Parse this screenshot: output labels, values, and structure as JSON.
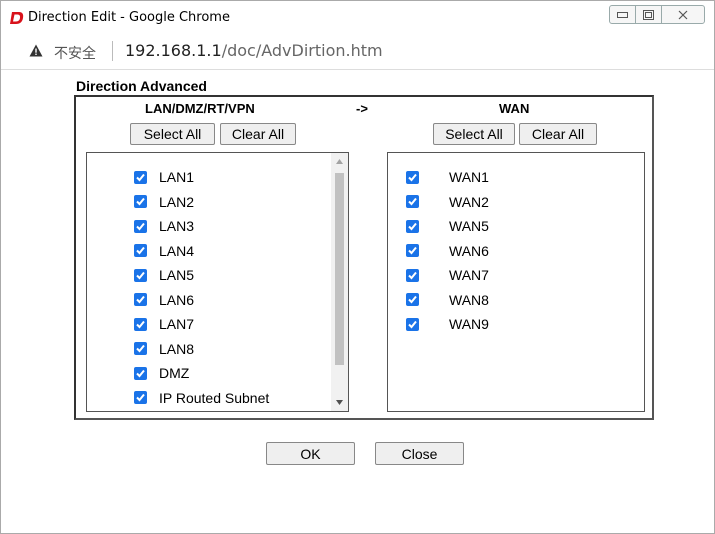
{
  "window": {
    "title": "Direction Edit - Google Chrome",
    "insecure_label": "不安全",
    "url_host": "192.168.1.1",
    "url_path": "/doc/AdvDirtion.htm"
  },
  "dialog": {
    "section_title": "Direction Advanced",
    "left_heading": "LAN/DMZ/RT/VPN",
    "arrow": "->",
    "right_heading": "WAN",
    "select_all_label": "Select All",
    "clear_all_label": "Clear All",
    "ok_label": "OK",
    "close_label": "Close",
    "checkbox_color": "#1a73e8"
  },
  "left_items": [
    {
      "label": "LAN1",
      "checked": true
    },
    {
      "label": "LAN2",
      "checked": true
    },
    {
      "label": "LAN3",
      "checked": true
    },
    {
      "label": "LAN4",
      "checked": true
    },
    {
      "label": "LAN5",
      "checked": true
    },
    {
      "label": "LAN6",
      "checked": true
    },
    {
      "label": "LAN7",
      "checked": true
    },
    {
      "label": "LAN8",
      "checked": true
    },
    {
      "label": "DMZ",
      "checked": true
    },
    {
      "label": "IP Routed Subnet",
      "checked": true
    }
  ],
  "right_items": [
    {
      "label": "WAN1",
      "checked": true
    },
    {
      "label": "WAN2",
      "checked": true
    },
    {
      "label": "WAN5",
      "checked": true
    },
    {
      "label": "WAN6",
      "checked": true
    },
    {
      "label": "WAN7",
      "checked": true
    },
    {
      "label": "WAN8",
      "checked": true
    },
    {
      "label": "WAN9",
      "checked": true
    }
  ]
}
